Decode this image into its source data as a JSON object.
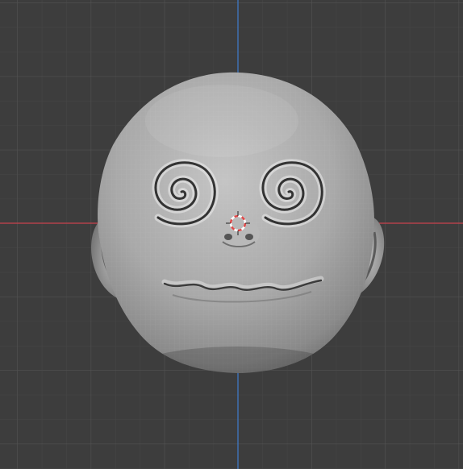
{
  "viewport": {
    "background": "#3d3d3d",
    "grid_minor_color": "#464646",
    "grid_major_color": "#555555",
    "x_axis_color": "#c8434e",
    "y_axis_color": "#3f78c4",
    "view": "front-orthographic"
  },
  "object": {
    "type": "sculpt-mesh",
    "subject": "cartoon head",
    "features": [
      "spiral-eyes",
      "nose",
      "wavy-mouth",
      "ears"
    ],
    "base_color": "#a6a6a6",
    "display": "wireframe-overlay"
  },
  "cursor_3d": {
    "icon": "3d-cursor-icon",
    "ring_colors": [
      "#e04848",
      "#ffffff"
    ]
  }
}
